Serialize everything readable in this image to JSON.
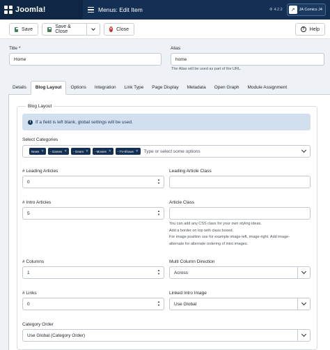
{
  "header": {
    "logo": "Joomla!",
    "title": "Menus: Edit Item",
    "version": "4.2.2",
    "site_button": "JA Comics J4"
  },
  "toolbar": {
    "save": "Save",
    "save_close": "Save & Close",
    "close": "Close",
    "help": "Help"
  },
  "form": {
    "title_label": "Title *",
    "title_value": "Home",
    "alias_label": "Alias",
    "alias_value": "home",
    "alias_hint": "The Alias will be used as part of the URL."
  },
  "tabs": [
    "Details",
    "Blog Layout",
    "Options",
    "Integration",
    "Link Type",
    "Page Display",
    "Metadata",
    "Open Graph",
    "Module Assignment"
  ],
  "active_tab": "Blog Layout",
  "blog_layout": {
    "legend": "Blog Layout",
    "alert": "If a field is left blank, global settings will be used.",
    "select_categories_label": "Select Categories",
    "categories": [
      "News",
      "- Games",
      "- Gears",
      "- Movies",
      "- TV-Shows"
    ],
    "categories_placeholder": "Type or select some options",
    "leading_articles_label": "# Leading Articles",
    "leading_articles_value": "0",
    "leading_class_label": "Leading Article Class",
    "intro_articles_label": "# Intro Articles",
    "intro_articles_value": "5",
    "article_class_label": "Article Class",
    "article_class_hint_1": "You can add any CSS class for your own styling ideas.",
    "article_class_hint_2": "Add a border on top with class boxed.",
    "article_class_hint_3": "For image position use for example image-left, image-right. Add image-",
    "article_class_hint_4": "alternate for alternate ordering of intro images.",
    "columns_label": "# Columns",
    "columns_value": "1",
    "multi_column_label": "Multi Column Direction",
    "multi_column_value": "Across",
    "links_label": "# Links",
    "links_value": "0",
    "linked_intro_label": "Linked Intro Image",
    "linked_intro_value": "Use Global",
    "category_order_label": "Category Order",
    "category_order_value": "Use Global (Category Order)"
  },
  "colors": {
    "header_bg": "#132f53",
    "save_icon": "#457d54",
    "close_icon": "#c52827",
    "alert_bg": "#d1dfef",
    "chip_bg": "#132f53"
  }
}
